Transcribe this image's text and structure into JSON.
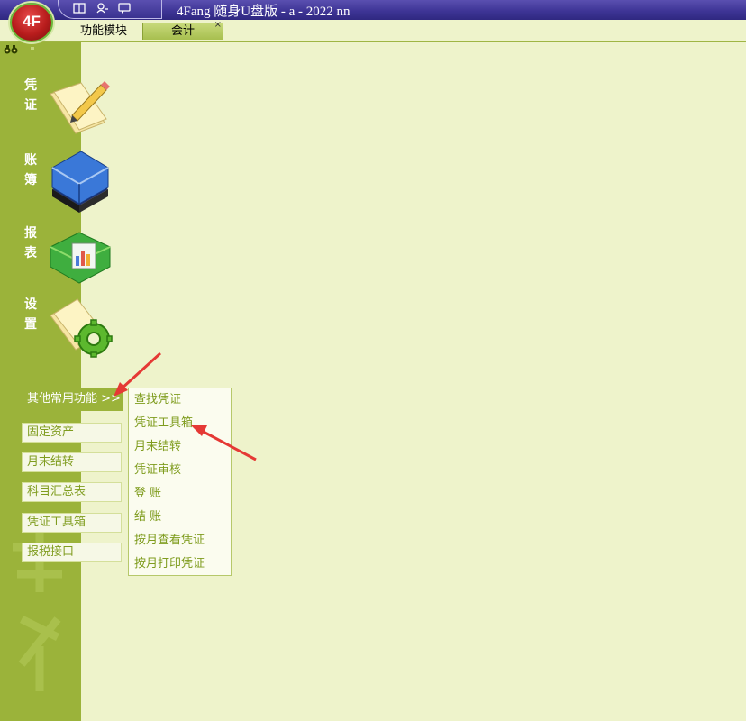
{
  "titlebar": {
    "title": "4Fang 随身U盘版  - a - 2022 nn",
    "logo_text": "4F",
    "tools": [
      "book-icon",
      "user-icon",
      "message-icon"
    ]
  },
  "tabs": {
    "modules": "功能模块",
    "accounting": "会计",
    "close": "×"
  },
  "sidebar": {
    "top_icon": "binoculars-icon",
    "nav": [
      {
        "label": "凭\n证",
        "icon": "voucher-notepad-icon"
      },
      {
        "label": "账\n簿",
        "icon": "ledger-book-icon"
      },
      {
        "label": "报\n表",
        "icon": "report-chart-icon"
      },
      {
        "label": "设\n置",
        "icon": "settings-gear-icon"
      }
    ]
  },
  "menu": {
    "other_functions": "其他常用功能 >>",
    "buttons": [
      "固定资产",
      "月末结转",
      "科目汇总表",
      "凭证工具箱",
      "报税接口"
    ],
    "submenu": [
      "查找凭证",
      "凭证工具箱",
      "月末结转",
      "凭证审核",
      "登  账",
      "结  账",
      "按月查看凭证",
      "按月打印凭证"
    ]
  },
  "colors": {
    "background": "#eef3cb",
    "sidebar": "#9bb33a",
    "titlebar": "#3e3596",
    "menu_text": "#7f9c1e",
    "annotation_arrow": "#e53935"
  }
}
